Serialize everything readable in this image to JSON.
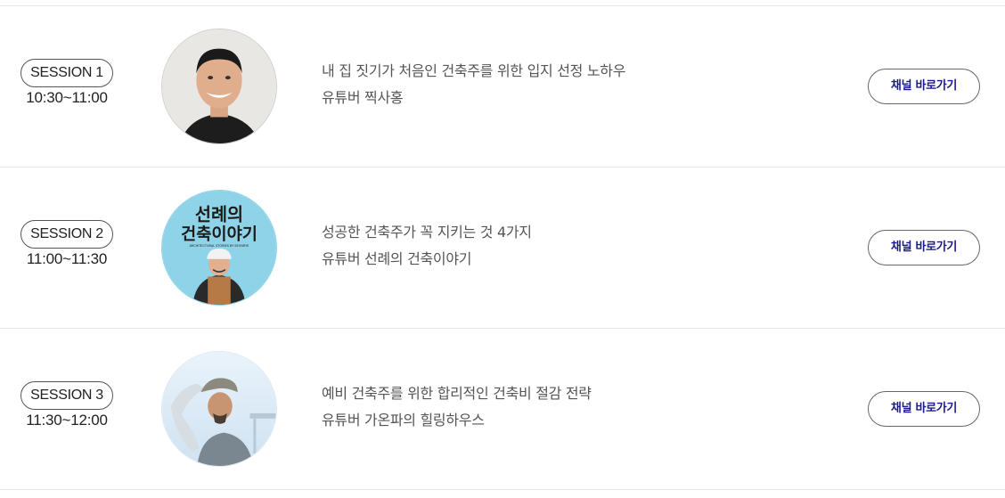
{
  "sessions": [
    {
      "label": "SESSION 1",
      "time": "10:30~11:00",
      "title": "내 집 짓기가 처음인 건축주를 위한 입지 선정 노하우",
      "host": "유튜버 찍사홍",
      "button": "채널 바로가기",
      "avatar_icon": "speaker-portrait-icon"
    },
    {
      "label": "SESSION 2",
      "time": "11:00~11:30",
      "title": "성공한 건축주가 꼭 지키는 것 4가지",
      "host": "유튜버 선례의 건축이야기",
      "button": "채널 바로가기",
      "avatar_icon": "channel-logo-icon",
      "avatar_text": {
        "line1": "선례의",
        "line2": "건축이야기",
        "sub": "ARCHITECTURAL STORIES BY SEONRYE"
      }
    },
    {
      "label": "SESSION 3",
      "time": "11:30~12:00",
      "title": "예비 건축주를 위한 합리적인 건축비 절감 전략",
      "host": "유튜버 가온파의 힐링하우스",
      "button": "채널 바로가기",
      "avatar_icon": "speaker-portrait-icon"
    }
  ],
  "colors": {
    "divider": "#e6e6e6",
    "button_text": "#1a1a8c",
    "text": "#555555",
    "avatar2_bg": "#8fd3e8"
  }
}
